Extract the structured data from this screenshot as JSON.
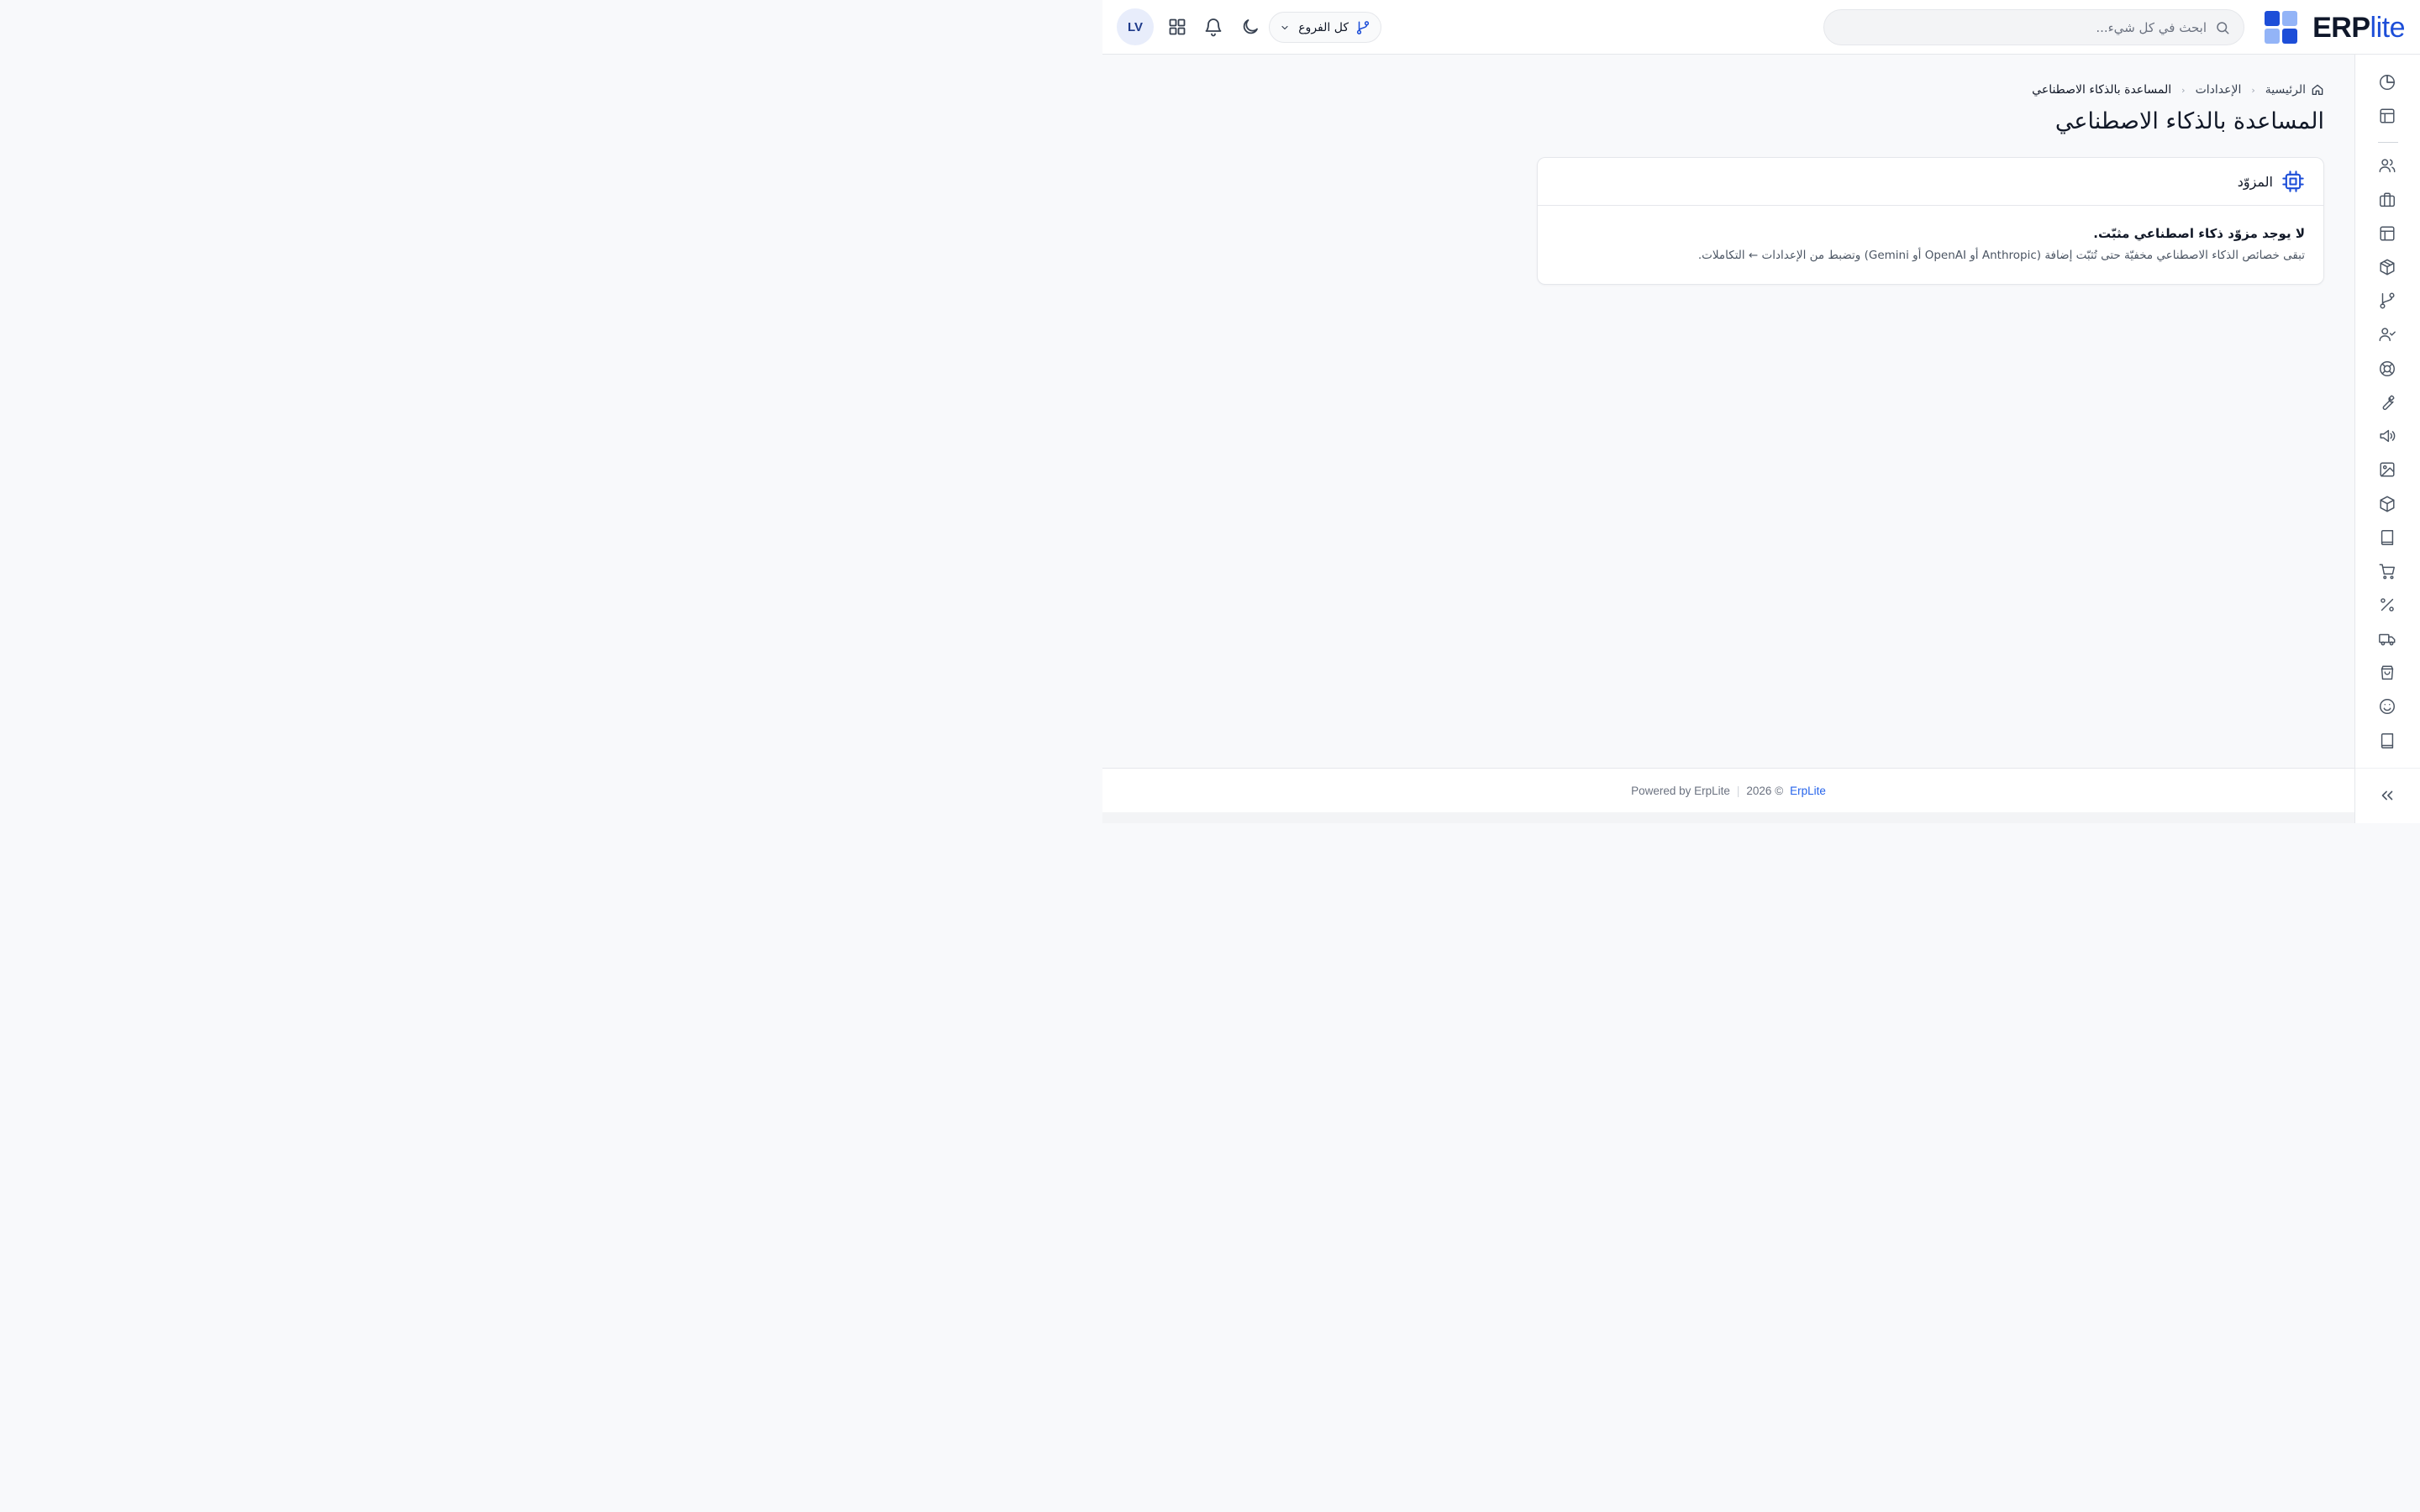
{
  "brand": {
    "logo_erp": "ERP",
    "logo_lite": "lite",
    "colors": {
      "primary_dark": "#1d4ed8",
      "primary_light": "#93b4f7",
      "logo_text": "#0f172a",
      "accent": "#2563eb"
    }
  },
  "topbar": {
    "search_placeholder": "ابحث في كل شيء...",
    "search_icon": "search-icon",
    "branch_selector": {
      "label": "كل الفروع",
      "icon": "git-branch-icon"
    },
    "actions": [
      "moon-icon",
      "bell-icon",
      "apps-grid-icon"
    ],
    "avatar_initials": "LV"
  },
  "sidebar": {
    "items": [
      "pie-chart-icon",
      "layout-icon",
      "users-icon",
      "briefcase-icon",
      "layout-icon",
      "package-icon",
      "git-branch-icon",
      "user-check-icon",
      "lifebuoy-icon",
      "wrench-icon",
      "megaphone-icon",
      "image-icon",
      "box-icon",
      "book-icon",
      "cart-icon",
      "percent-icon",
      "truck-icon",
      "shopping-bag-icon",
      "smile-icon",
      "book-icon"
    ],
    "collapse_icon": "chevrons-left-icon"
  },
  "breadcrumb": {
    "home": "الرئيسية",
    "settings": "الإعدادات",
    "current": "المساعدة بالذكاء الاصطناعي"
  },
  "page": {
    "title": "المساعدة بالذكاء الاصطناعي"
  },
  "card": {
    "icon": "cpu-chip-icon",
    "title": "المزوّد",
    "empty_title": "لا يوجد مزوّد ذكاء اصطناعي مثبّت.",
    "empty_description": "تبقى خصائص الذكاء الاصطناعي مخفيّة حتى تُثبّت إضافة (Anthropic أو OpenAI أو Gemini) وتضبط من الإعدادات ← التكاملات."
  },
  "footer": {
    "powered_by": "Powered by ErpLite",
    "separator": "|",
    "year": "2026 ©",
    "brand_link": "ErpLite"
  }
}
